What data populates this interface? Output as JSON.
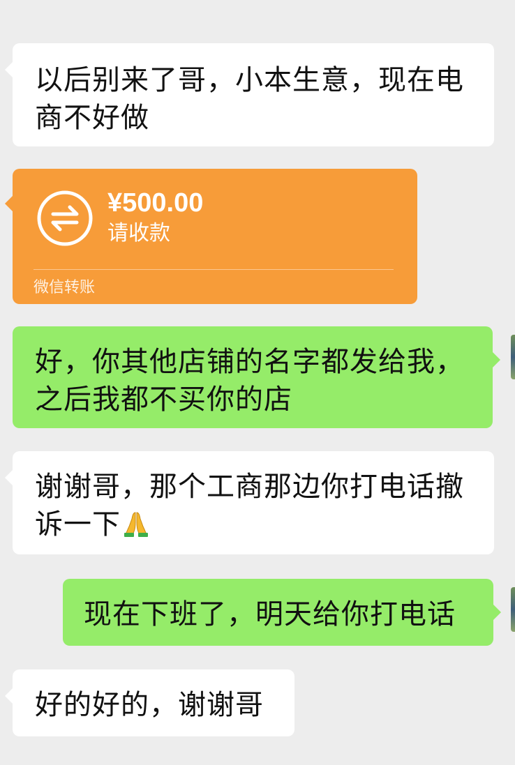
{
  "messages": [
    {
      "id": "m1",
      "direction": "incoming",
      "text": "以后别来了哥，小本生意，现在电商不好做"
    },
    {
      "id": "m2",
      "direction": "incoming",
      "type": "transfer",
      "amount": "¥500.00",
      "status": "请收款",
      "label": "微信转账",
      "color": "#f79c39"
    },
    {
      "id": "m3",
      "direction": "outgoing",
      "text": "好，你其他店铺的名字都发给我，之后我都不买你的店"
    },
    {
      "id": "m4",
      "direction": "incoming",
      "text": "谢谢哥，那个工商那边你打电话撤诉一下",
      "emoji": "folded-hands-icon"
    },
    {
      "id": "m5",
      "direction": "outgoing",
      "text": "现在下班了，明天给你打电话"
    },
    {
      "id": "m6",
      "direction": "incoming",
      "text": "好的好的，谢谢哥"
    }
  ],
  "colors": {
    "background": "#ededed",
    "incoming_bubble": "#ffffff",
    "outgoing_bubble": "#95ec69",
    "transfer_bubble": "#f79c39"
  }
}
